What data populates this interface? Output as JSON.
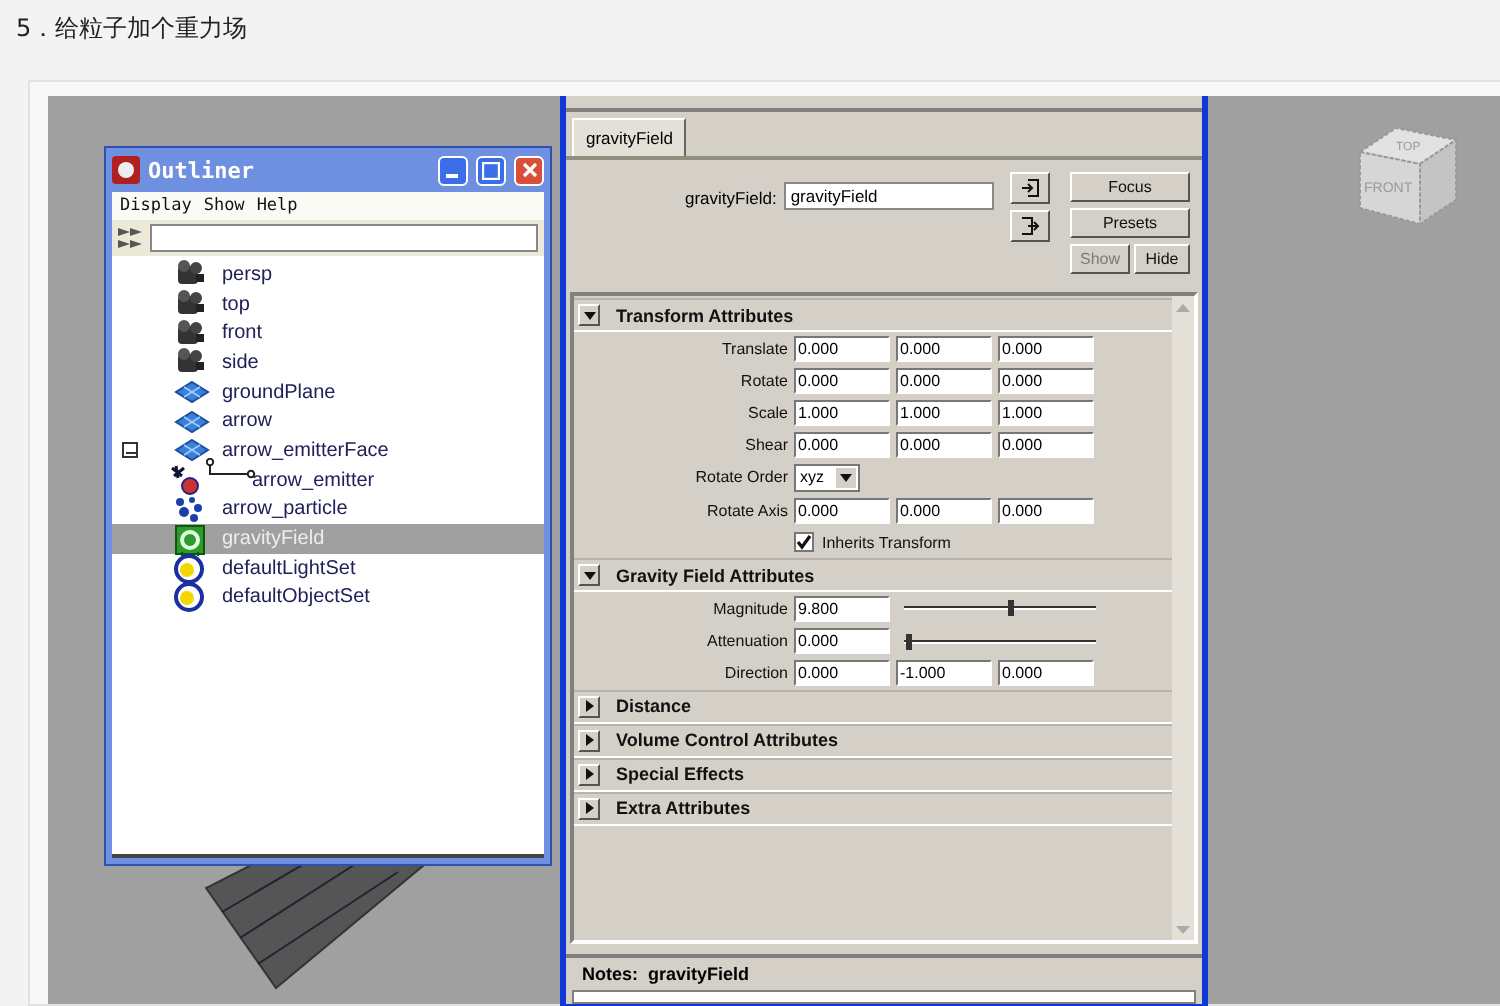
{
  "heading": "5．给粒子加个重力场",
  "outliner": {
    "title": "Outliner",
    "menu": [
      "Display",
      "Show",
      "Help"
    ],
    "items": [
      {
        "label": "persp",
        "kind": "camera",
        "selected": false
      },
      {
        "label": "top",
        "kind": "camera",
        "selected": false
      },
      {
        "label": "front",
        "kind": "camera",
        "selected": false
      },
      {
        "label": "side",
        "kind": "camera",
        "selected": false
      },
      {
        "label": "groundPlane",
        "kind": "mesh",
        "selected": false
      },
      {
        "label": "arrow",
        "kind": "mesh",
        "selected": false
      },
      {
        "label": "arrow_emitterFace",
        "kind": "mesh",
        "selected": false,
        "expanded": true,
        "children": [
          {
            "label": "arrow_emitter",
            "kind": "emitter",
            "selected": false
          }
        ]
      },
      {
        "label": "arrow_particle",
        "kind": "particle",
        "selected": false
      },
      {
        "label": "gravityField",
        "kind": "field",
        "selected": true
      },
      {
        "label": "defaultLightSet",
        "kind": "set",
        "selected": false
      },
      {
        "label": "defaultObjectSet",
        "kind": "set",
        "selected": false
      }
    ]
  },
  "attribute_editor": {
    "tab": {
      "label": "gravityField",
      "selected": true
    },
    "node_label": "gravityField:",
    "node_name": "gravityField",
    "buttons": [
      {
        "label": "Focus",
        "disabled": false
      },
      {
        "label": "Presets",
        "disabled": false
      },
      {
        "label": "Show",
        "disabled": true
      },
      {
        "label": "Hide",
        "disabled": false
      }
    ],
    "sections": [
      {
        "title": "Transform Attributes",
        "expanded": true,
        "rows": [
          {
            "kind": "fields",
            "label": "Translate",
            "values": [
              "0.000",
              "0.000",
              "0.000"
            ]
          },
          {
            "kind": "fields",
            "label": "Rotate",
            "values": [
              "0.000",
              "0.000",
              "0.000"
            ]
          },
          {
            "kind": "fields",
            "label": "Scale",
            "values": [
              "1.000",
              "1.000",
              "1.000"
            ]
          },
          {
            "kind": "fields",
            "label": "Shear",
            "values": [
              "0.000",
              "0.000",
              "0.000"
            ]
          },
          {
            "kind": "dropdown",
            "label": "Rotate Order",
            "value": "xyz"
          },
          {
            "kind": "fields",
            "label": "Rotate Axis",
            "values": [
              "0.000",
              "0.000",
              "0.000"
            ]
          },
          {
            "kind": "checkbox",
            "label": "Inherits Transform",
            "checked": true
          }
        ]
      },
      {
        "title": "Gravity Field Attributes",
        "expanded": true,
        "rows": [
          {
            "kind": "slider",
            "label": "Magnitude",
            "value": "9.800",
            "level": 0.55
          },
          {
            "kind": "slider",
            "label": "Attenuation",
            "value": "0.000",
            "level": 0.02
          },
          {
            "kind": "fields",
            "label": "Direction",
            "values": [
              "0.000",
              "-1.000",
              "0.000"
            ]
          }
        ]
      },
      {
        "title": "Distance",
        "expanded": false
      },
      {
        "title": "Volume Control Attributes",
        "expanded": false
      },
      {
        "title": "Special Effects",
        "expanded": false
      },
      {
        "title": "Extra Attributes",
        "expanded": false
      }
    ],
    "notes": {
      "label": "Notes:",
      "value": "gravityField"
    }
  },
  "view_cube": {
    "faces": [
      "TOP",
      "FRONT"
    ]
  }
}
